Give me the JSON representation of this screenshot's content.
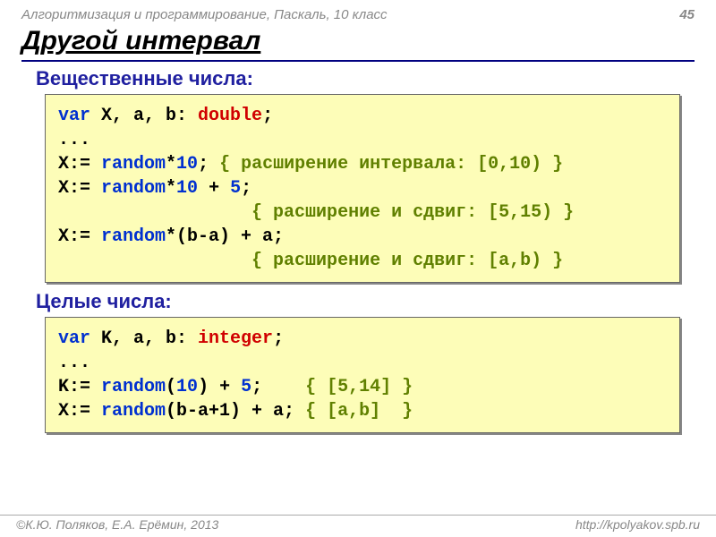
{
  "header": {
    "course": "Алгоритмизация и программирование, Паскаль, 10 класс",
    "page": "45"
  },
  "title": "Другой интервал",
  "section1": {
    "heading": "Вещественные числа:",
    "code": {
      "l1a": "var",
      "l1b": " X, a, b: ",
      "l1c": "double",
      "l1d": ";",
      "l2": "...",
      "l3a": "X:= ",
      "l3b": "random",
      "l3c": "*",
      "l3d": "10",
      "l3e": "; ",
      "l3f": "{ расширение интервала: [0,10) }",
      "l4a": "X:= ",
      "l4b": "random",
      "l4c": "*",
      "l4d": "10",
      "l4e": " + ",
      "l4f": "5",
      "l4g": ";",
      "l5a": "                  ",
      "l5b": "{ расширение и сдвиг: [5,15) }",
      "l6a": "X:= ",
      "l6b": "random",
      "l6c": "*(b-a) + a;",
      "l7a": "                  ",
      "l7b": "{ расширение и сдвиг: [a,b) }"
    }
  },
  "section2": {
    "heading": "Целые числа:",
    "code": {
      "l1a": "var",
      "l1b": " K, a, b: ",
      "l1c": "integer",
      "l1d": ";",
      "l2": "...",
      "l3a": "K:= ",
      "l3b": "random",
      "l3c": "(",
      "l3d": "10",
      "l3e": ") + ",
      "l3f": "5",
      "l3g": ";    ",
      "l3h": "{ [5,14] }",
      "l4a": "X:= ",
      "l4b": "random",
      "l4c": "(b-a+1) + a; ",
      "l4d": "{ [a,b]  }"
    }
  },
  "footer": {
    "left": "©К.Ю. Поляков, Е.А. Ерёмин, 2013",
    "right": "http://kpolyakov.spb.ru"
  }
}
